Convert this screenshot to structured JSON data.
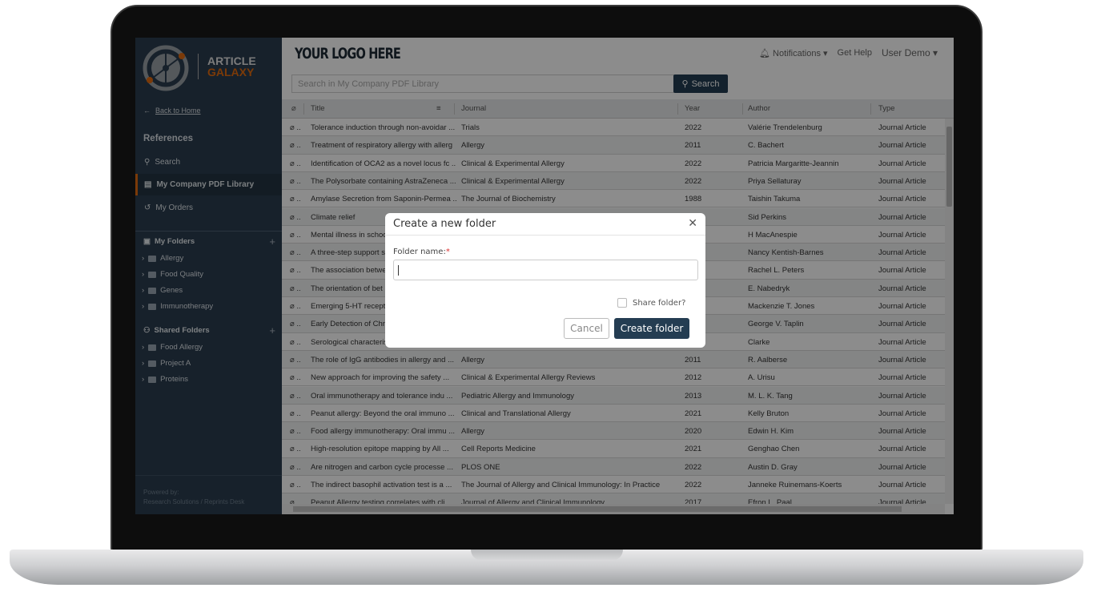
{
  "brand": {
    "line1": "ARTICLE",
    "line2": "GALAXY",
    "accent": "#e06a10"
  },
  "sidebar": {
    "back": "Back to Home",
    "references": "References",
    "nav": [
      {
        "label": "Search",
        "icon": "search-icon"
      },
      {
        "label": "My Company PDF Library",
        "icon": "pdf-icon",
        "active": true
      },
      {
        "label": "My Orders",
        "icon": "history-icon"
      }
    ],
    "my_folders": {
      "title": "My Folders",
      "items": [
        "Allergy",
        "Food Quality",
        "Genes",
        "Immunotherapy"
      ]
    },
    "shared_folders": {
      "title": "Shared Folders",
      "items": [
        "Food Allergy",
        "Project A",
        "Proteins"
      ]
    },
    "powered_by": "Powered by:",
    "powered_name": "Research Solutions / Reprints Desk"
  },
  "header": {
    "logo_text": "YOUR LOGO HERE",
    "notifications": "Notifications",
    "help": "Get Help",
    "user": "User Demo"
  },
  "search": {
    "placeholder": "Search in My Company PDF Library",
    "button": "Search"
  },
  "table": {
    "columns": [
      "Title",
      "Journal",
      "Year",
      "Author",
      "Type"
    ],
    "rows": [
      [
        "Tolerance induction through non-avoidar ...",
        "Trials",
        "2022",
        "Valérie Trendelenburg",
        "Journal Article"
      ],
      [
        "Treatment of respiratory allergy with allerg",
        "Allergy",
        "2011",
        "C. Bachert",
        "Journal Article"
      ],
      [
        "Identification of OCA2 as a novel locus fc ...",
        "Clinical & Experimental Allergy",
        "2022",
        "Patricia Margaritte-Jeannin",
        "Journal Article"
      ],
      [
        "The Polysorbate containing AstraZeneca ...",
        "Clinical & Experimental Allergy",
        "2022",
        "Priya Sellaturay",
        "Journal Article"
      ],
      [
        "Amylase Secretion from Saponin-Permea ...",
        "The Journal of Biochemistry",
        "1988",
        "Taishin Takuma",
        "Journal Article"
      ],
      [
        "Climate relief",
        "",
        "",
        "Sid Perkins",
        "Journal Article"
      ],
      [
        "Mental illness in schoo",
        "",
        "",
        "H MacAnespie",
        "Journal Article"
      ],
      [
        "A three-step support s",
        "",
        "",
        "Nancy Kentish-Barnes",
        "Journal Article"
      ],
      [
        "The association betwe",
        "",
        "",
        "Rachel L. Peters",
        "Journal Article"
      ],
      [
        "The orientation of bet",
        "",
        "",
        "E. Nabedryk",
        "Journal Article"
      ],
      [
        "Emerging 5-HT recept",
        "",
        "",
        "Mackenzie T. Jones",
        "Journal Article"
      ],
      [
        "Early Detection of Chr",
        "",
        "",
        "George V. Taplin",
        "Journal Article"
      ],
      [
        "Serological characteris",
        "",
        "",
        "Clarke",
        "Journal Article"
      ],
      [
        "The role of IgG antibodies in allergy and ...",
        "Allergy",
        "2011",
        "R. Aalberse",
        "Journal Article"
      ],
      [
        "New approach for improving the safety ...",
        "Clinical & Experimental Allergy Reviews",
        "2012",
        "A. Urisu",
        "Journal Article"
      ],
      [
        "Oral immunotherapy and tolerance indu ...",
        "Pediatric Allergy and Immunology",
        "2013",
        "M. L. K. Tang",
        "Journal Article"
      ],
      [
        "Peanut allergy: Beyond the oral immuno ...",
        "Clinical and Translational Allergy",
        "2021",
        "Kelly Bruton",
        "Journal Article"
      ],
      [
        "Food allergy immunotherapy: Oral immu ...",
        "Allergy",
        "2020",
        "Edwin H. Kim",
        "Journal Article"
      ],
      [
        "High-resolution epitope mapping by All ...",
        "Cell Reports Medicine",
        "2021",
        "Genghao Chen",
        "Journal Article"
      ],
      [
        "Are nitrogen and carbon cycle processe ...",
        "PLOS ONE",
        "2022",
        "Austin D. Gray",
        "Journal Article"
      ],
      [
        "The indirect basophil activation test is a ...",
        "The Journal of Allergy and Clinical Immunology: In Practice",
        "2022",
        "Janneke Ruinemans-Koerts",
        "Journal Article"
      ],
      [
        "Peanut Allergy testing correlates with cli ...",
        "Journal of Allergy and Clinical Immunology",
        "2017",
        "Efron L. Paal",
        "Journal Article"
      ]
    ]
  },
  "modal": {
    "title": "Create a new folder",
    "field_label": "Folder name:",
    "required_mark": "*",
    "field_value": "",
    "share_label": "Share folder?",
    "share_checked": false,
    "cancel": "Cancel",
    "create": "Create folder"
  }
}
